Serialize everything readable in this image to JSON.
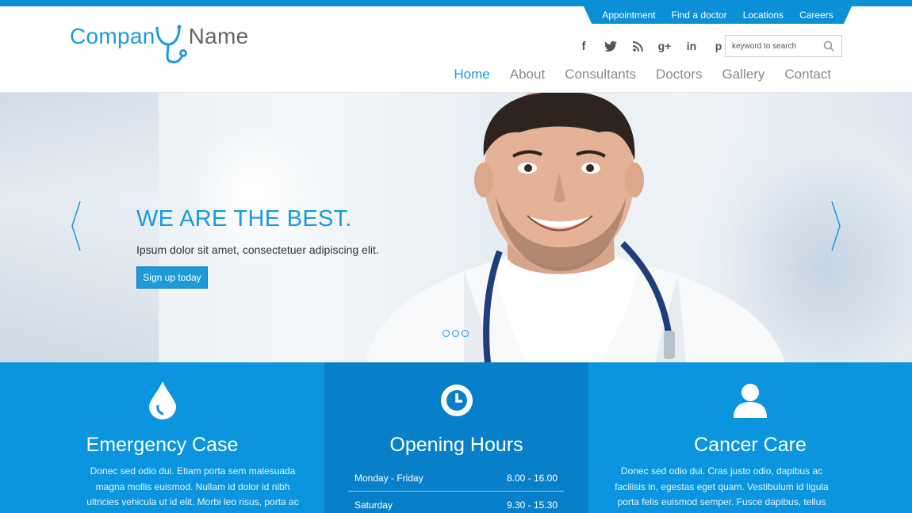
{
  "toplinks": [
    "Appointment",
    "Find a doctor",
    "Locations",
    "Careers"
  ],
  "logo": {
    "part1": "Compan",
    "part2": "Name"
  },
  "social": [
    "facebook-icon",
    "twitter-icon",
    "rss-icon",
    "google-plus-icon",
    "linkedin-icon",
    "pinterest-icon"
  ],
  "search": {
    "placeholder": "keyword to search"
  },
  "nav": [
    "Home",
    "About",
    "Consultants",
    "Doctors",
    "Gallery",
    "Contact"
  ],
  "hero": {
    "title": "WE ARE THE BEST.",
    "subtitle": "Ipsum dolor sit amet, consectetuer adipiscing elit.",
    "button": "Sign up today"
  },
  "panels": {
    "emergency": {
      "title": "Emergency Case",
      "text": "Donec sed odio dui. Etiam porta sem malesuada magna mollis euismod. Nullam id dolor id nibh ultricies vehicula ut id elit. Morbi leo risus, porta ac"
    },
    "hours": {
      "title": "Opening Hours",
      "rows": [
        {
          "days": "Monday - Friday",
          "time": "8.00 - 16.00"
        },
        {
          "days": "Saturday",
          "time": "9.30 - 15.30"
        }
      ]
    },
    "cancer": {
      "title": "Cancer Care",
      "text": "Donec sed odio dui. Cras justo odio, dapibus ac facilisis in, egestas eget quam. Vestibulum id ligula porta felis euismod semper. Fusce dapibus, tellus"
    }
  },
  "colors": {
    "accent": "#1b9bd8",
    "panel": "#0b95de",
    "panel_dark": "#0880c9"
  }
}
